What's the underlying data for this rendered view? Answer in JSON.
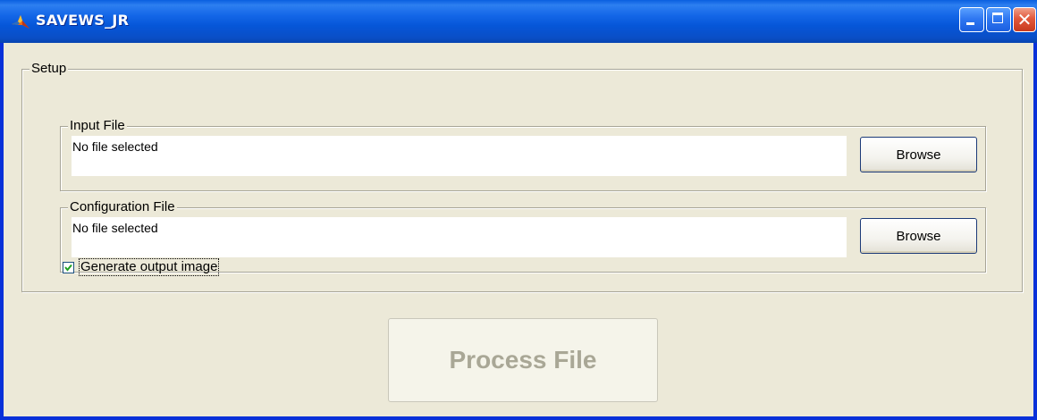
{
  "window": {
    "title": "SAVEWS_JR",
    "icon": "matlab-logo-icon",
    "controls": [
      "minimize-icon",
      "maximize-icon",
      "close-icon"
    ],
    "close_glyph": "✕"
  },
  "setup": {
    "legend": "Setup",
    "input_file": {
      "legend": "Input File",
      "value": "No file selected",
      "button_label": "Browse"
    },
    "config_file": {
      "legend": "Configuration File",
      "value": "No file selected",
      "button_label": "Browse"
    },
    "generate_output": {
      "label": "Generate output image",
      "checked": true
    }
  },
  "process_button": {
    "label": "Process File",
    "enabled": false
  },
  "colors": {
    "titlebar": "#0a5fe0",
    "client_bg": "#ece9d8",
    "disabled_text": "#a9a796"
  }
}
